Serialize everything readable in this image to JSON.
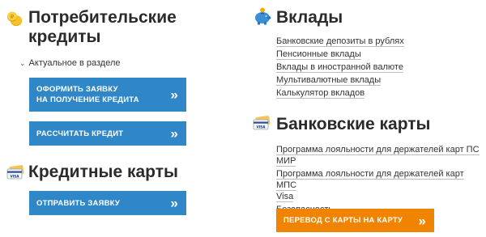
{
  "consumer_credit": {
    "title_line1": "Потребительские",
    "title_line2": "кредиты",
    "sub_link": "Актуальное в разделе",
    "apply_button_line1": "ОФОРМИТЬ ЗАЯВКУ",
    "apply_button_line2": "НА ПОЛУЧЕНИЕ КРЕДИТА",
    "calc_button": "РАССЧИТАТЬ КРЕДИТ"
  },
  "credit_cards": {
    "title": "Кредитные карты",
    "apply_button": "ОТПРАВИТЬ ЗАЯВКУ"
  },
  "deposits": {
    "title": "Вклады",
    "links": [
      "Банковские депозиты в рублях",
      "Пенсионные вклады",
      "Вклады в иностранной валюте",
      "Мультивалютные вклады",
      "Калькулятор вкладов"
    ]
  },
  "bank_cards": {
    "title": "Банковские карты",
    "link1_line1": "Программа лояльности для держателей карт ПС",
    "link1_line2": "МИР",
    "link2_line1": "Программа лояльности для держателей карт МПС",
    "link2_line2": "Visa",
    "link3": "Безопасность",
    "transfer_button": "ПЕРЕВОД С КАРТЫ НА КАРТУ"
  },
  "arrows_glyph": "»",
  "colors": {
    "button_blue": "#2f87c8",
    "button_orange": "#f08400",
    "coin_gold": "#f4b200",
    "piggy_blue": "#3a8fd6"
  },
  "icons": [
    "coins-icon",
    "card-icon",
    "piggy-bank-icon",
    "card-icon"
  ]
}
